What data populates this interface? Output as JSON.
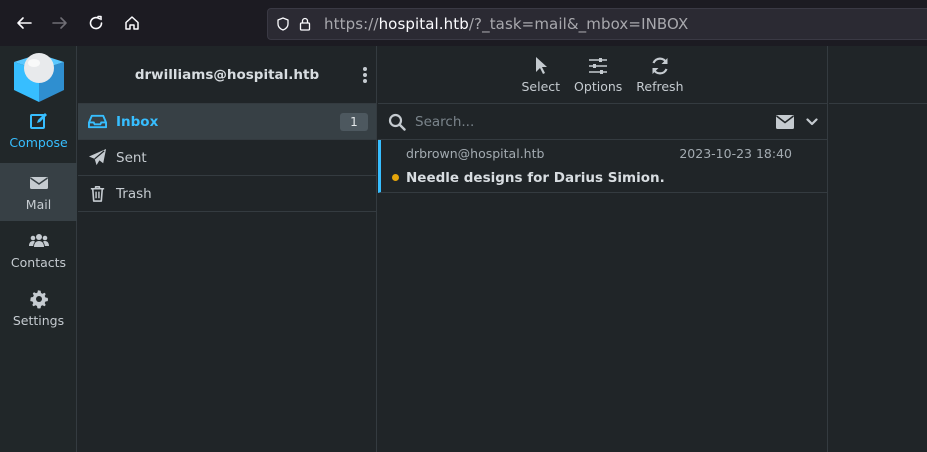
{
  "browser": {
    "url_scheme": "https://",
    "url_host": "hospital.htb",
    "url_path": "/?_task=mail&_mbox=INBOX"
  },
  "nav": {
    "items": [
      {
        "label": "Compose",
        "icon": "compose-icon"
      },
      {
        "label": "Mail",
        "icon": "mail-icon"
      },
      {
        "label": "Contacts",
        "icon": "contacts-icon"
      },
      {
        "label": "Settings",
        "icon": "gear-icon"
      }
    ]
  },
  "folders": {
    "account": "drwilliams@hospital.htb",
    "items": [
      {
        "label": "Inbox",
        "unread": "1",
        "icon": "inbox-icon"
      },
      {
        "label": "Sent",
        "icon": "sent-icon"
      },
      {
        "label": "Trash",
        "icon": "trash-icon"
      }
    ]
  },
  "toolbar": {
    "select_label": "Select",
    "options_label": "Options",
    "refresh_label": "Refresh"
  },
  "search": {
    "placeholder": "Search..."
  },
  "messages": [
    {
      "from": "drbrown@hospital.htb",
      "date": "2023-10-23 18:40",
      "subject": "Needle designs for Darius Simion.",
      "unread": true
    }
  ],
  "colors": {
    "accent": "#37beff",
    "unread_dot": "#e5a50a",
    "background": "#202528"
  }
}
